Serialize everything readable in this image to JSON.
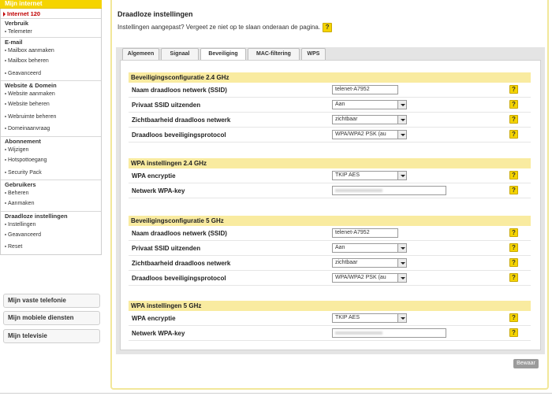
{
  "sidebar": {
    "header": "Mijn internet",
    "active_item": "Internet 120",
    "groups": [
      {
        "title": "Verbruik",
        "items": [
          "Telemeter"
        ]
      },
      {
        "title": "E-mail",
        "items": [
          "Mailbox aanmaken",
          "Mailbox beheren",
          "Geavanceerd"
        ]
      },
      {
        "title": "Website & Domein",
        "items": [
          "Website aanmaken",
          "Website beheren",
          "Webruimte beheren",
          "Domeinaanvraag"
        ]
      },
      {
        "title": "Abonnement",
        "items": [
          "Wijzigen",
          "Hotspottoegang",
          "Security Pack"
        ]
      },
      {
        "title": "Gebruikers",
        "items": [
          "Beheren",
          "Aanmaken"
        ]
      },
      {
        "title": "Draadloze instellingen",
        "items": [
          "Instellingen",
          "Geavanceerd",
          "Reset"
        ]
      }
    ],
    "buttons": [
      "Mijn vaste telefonie",
      "Mijn mobiele diensten",
      "Mijn televisie"
    ]
  },
  "main": {
    "title": "Draadloze instellingen",
    "notice": "Instellingen aangepast? Vergeet ze niet op te slaan onderaan de pagina.",
    "help_symbol": "?",
    "tabs": [
      "Algemeen",
      "Signaal",
      "Beveiliging",
      "MAC-filtering",
      "WPS"
    ],
    "active_tab": "Beveiliging",
    "save_label": "Bewaar"
  },
  "sections": [
    {
      "title": "Beveiligingsconfiguratie 2.4 GHz",
      "rows": [
        {
          "label": "Naam draadloos netwerk (SSID)",
          "value": "telenet-A7952",
          "kind": "text"
        },
        {
          "label": "Privaat SSID uitzenden",
          "value": "Aan",
          "kind": "select"
        },
        {
          "label": "Zichtbaarheid draadloos netwerk",
          "value": "zichtbaar",
          "kind": "select"
        },
        {
          "label": "Draadloos beveiligingsprotocol",
          "value": "WPA/WPA2 PSK (au",
          "kind": "select"
        }
      ]
    },
    {
      "title": "WPA instellingen 2.4 GHz",
      "rows": [
        {
          "label": "WPA encryptie",
          "value": "TKIP AES",
          "kind": "select"
        },
        {
          "label": "Netwerk WPA-key",
          "value": "",
          "kind": "key"
        }
      ]
    },
    {
      "title": "Beveiligingsconfiguratie 5 GHz",
      "rows": [
        {
          "label": "Naam draadloos netwerk (SSID)",
          "value": "telenet-A7952",
          "kind": "text"
        },
        {
          "label": "Privaat SSID uitzenden",
          "value": "Aan",
          "kind": "select"
        },
        {
          "label": "Zichtbaarheid draadloos netwerk",
          "value": "zichtbaar",
          "kind": "select"
        },
        {
          "label": "Draadloos beveiligingsprotocol",
          "value": "WPA/WPA2 PSK (au",
          "kind": "select"
        }
      ]
    },
    {
      "title": "WPA instellingen 5 GHz",
      "rows": [
        {
          "label": "WPA encryptie",
          "value": "TKIP AES",
          "kind": "select"
        },
        {
          "label": "Netwerk WPA-key",
          "value": "",
          "kind": "key"
        }
      ]
    }
  ],
  "colors": {
    "accent": "#f5d400",
    "section_head": "#f9eba0",
    "active_red": "#c00000"
  }
}
